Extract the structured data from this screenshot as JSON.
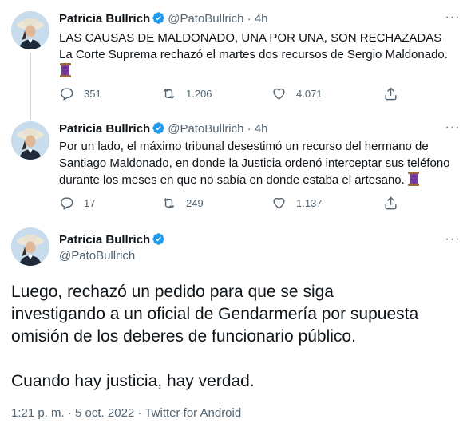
{
  "author": {
    "name": "Patricia Bullrich",
    "handle": "@PatoBullrich"
  },
  "tweets": [
    {
      "time": "4h",
      "lines": [
        "LAS CAUSAS DE MALDONADO, UNA POR UNA, SON RECHAZADAS",
        "La Corte Suprema rechazó el martes dos recursos de Sergio Maldonado."
      ],
      "stats": {
        "replies": "351",
        "retweets": "1.206",
        "likes": "4.071"
      }
    },
    {
      "time": "4h",
      "lines": [
        "Por un lado, el máximo tribunal desestimó un recurso del hermano de",
        "Santiago Maldonado, en donde la Justicia ordenó interceptar sus teléfono",
        "durante los meses en que no sabía en donde estaba el artesano."
      ],
      "stats": {
        "replies": "17",
        "retweets": "249",
        "likes": "1.137"
      }
    }
  ],
  "main_tweet": {
    "paragraph1": [
      "Luego, rechazó un pedido para que se siga",
      "investigando a un oficial de Gendarmería por supuesta",
      "omisión de los deberes de funcionario público."
    ],
    "paragraph2": "Cuando hay justicia, hay verdad.",
    "timestamp": "1:21 p. m. · 5 oct. 2022 · Twitter for Android"
  },
  "ui": {
    "separator": "·",
    "more_label": "···",
    "emoji": "spool-of-thread",
    "colors": {
      "verified": "#1d9bf0",
      "muted": "#536471",
      "thread_line": "#cfd9de"
    }
  }
}
